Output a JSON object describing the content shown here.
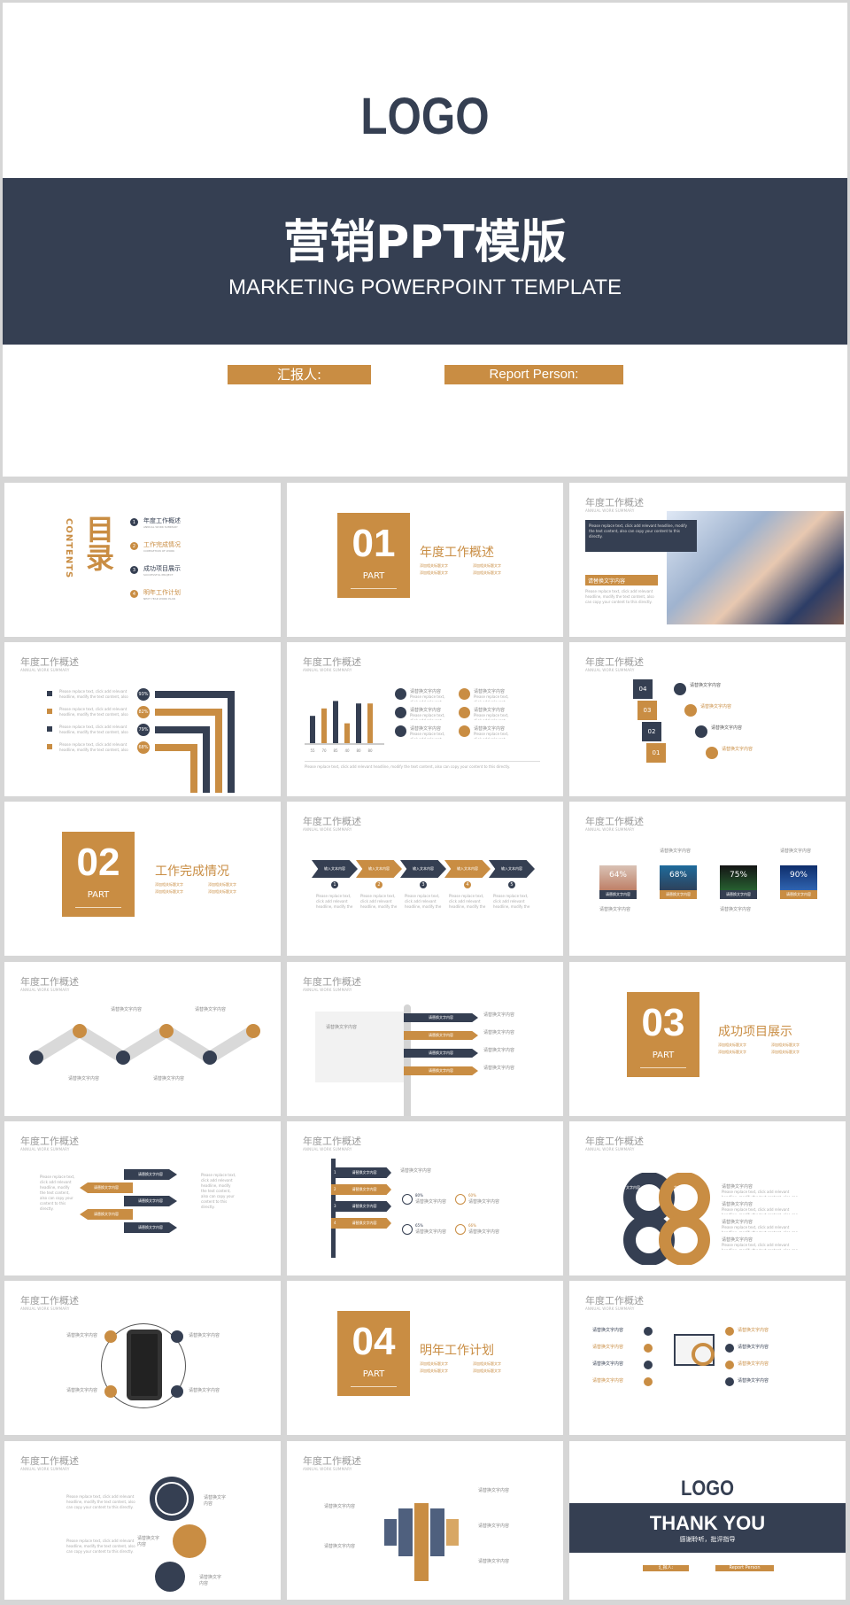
{
  "colors": {
    "navy": "#353f52",
    "gold": "#c98d43"
  },
  "cover": {
    "logo": "LOGO",
    "title": "营销PPT模版",
    "subtitle": "MARKETING POWERPOINT TEMPLATE",
    "reporter_label": "汇报人:",
    "reporter_label_en": "Report Person:"
  },
  "common": {
    "header": "年度工作概述",
    "header_en": "ANNUAL WORK SUMMARY",
    "replace_text": "请替换文字内容",
    "input_text": "输入文本内容",
    "add_title": "添加相关标题文字",
    "lorem": "Please replace text, click add relevant headline, modify the text content, also can copy your content to this directly.",
    "part": "PART"
  },
  "contents": {
    "title": "目录",
    "title_en": "CONTENTS",
    "items": [
      {
        "num": "1",
        "label": "年度工作概述",
        "en": "ANNUAL WORK SUMMARY"
      },
      {
        "num": "2",
        "label": "工作完成情况",
        "en": "COMPLETION OF WORK"
      },
      {
        "num": "3",
        "label": "成功项目展示",
        "en": "SUCCESSFUL PROJECT"
      },
      {
        "num": "4",
        "label": "明年工作计划",
        "en": "NEXT YEAR WORK PLAN"
      }
    ]
  },
  "parts": [
    {
      "num": "01",
      "title": "年度工作概述"
    },
    {
      "num": "02",
      "title": "工作完成情况"
    },
    {
      "num": "03",
      "title": "成功项目展示"
    },
    {
      "num": "04",
      "title": "明年工作计划"
    }
  ],
  "arrows_percent": [
    "93%",
    "82%",
    "79%",
    "68%"
  ],
  "chart_data": {
    "type": "bar",
    "categories": [
      "55",
      "70",
      "85",
      "40",
      "80",
      "80"
    ],
    "values": [
      55,
      70,
      85,
      40,
      80,
      80
    ],
    "ylim": [
      0,
      100
    ]
  },
  "steps": [
    "04",
    "03",
    "02",
    "01"
  ],
  "process": [
    "1",
    "2",
    "3",
    "4",
    "5"
  ],
  "photo_percents": [
    "64%",
    "68%",
    "75%",
    "90%"
  ],
  "pencil_stats": [
    "80%",
    "60%",
    "65%",
    "66%"
  ],
  "pencil_nums": [
    "1",
    "2",
    "3",
    "4"
  ],
  "knot_text": "文字内容",
  "thanks": {
    "logo": "LOGO",
    "title": "THANK YOU",
    "subtitle": "感谢聆听，批评指导",
    "reporter_label": "汇报人:",
    "reporter_label_en": "Report Person"
  }
}
